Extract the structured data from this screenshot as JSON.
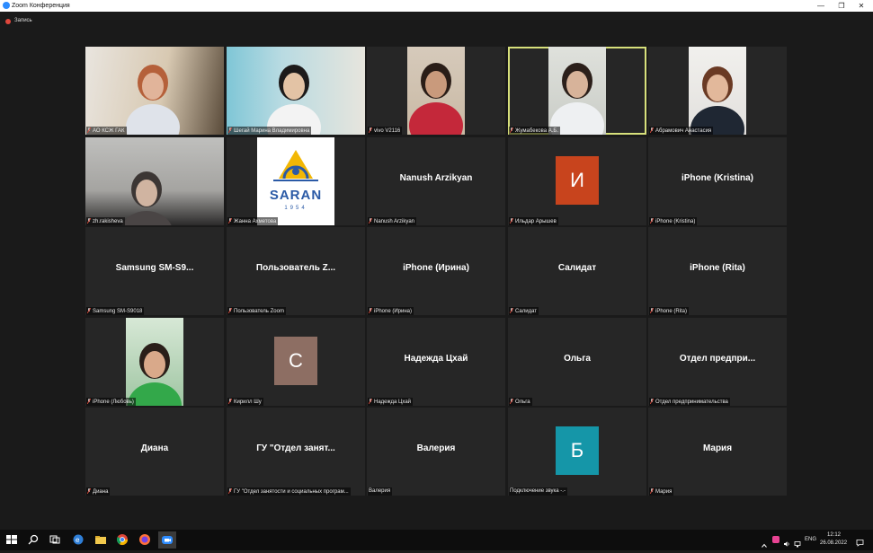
{
  "window": {
    "title": "Zoom Конференция"
  },
  "recording": {
    "label": "Запись"
  },
  "colors": {
    "active_speaker_border": "#d7e07b",
    "avatar_orange": "#c8441d",
    "avatar_brown": "#8d6e63",
    "avatar_teal": "#1596a8",
    "mute_icon": "#e04b3c"
  },
  "participants": [
    {
      "label": "АО КСЖ ГАК",
      "display": "",
      "type": "video"
    },
    {
      "label": "Шегай Марина Владимировна",
      "display": "",
      "type": "video"
    },
    {
      "label": "vivo V2116",
      "display": "",
      "type": "video"
    },
    {
      "label": "Жумабекова А.Б.",
      "display": "",
      "type": "video",
      "active": true
    },
    {
      "label": "Абрамович Анастасия",
      "display": "",
      "type": "video"
    },
    {
      "label": "zh.rakisheva",
      "display": "",
      "type": "video"
    },
    {
      "label": "Жанна Ахметова",
      "display": "",
      "type": "logo",
      "logo_text": "SARAN",
      "logo_year": "1954"
    },
    {
      "label": "Nanush Arzikyan",
      "display": "Nanush Arzikyan",
      "type": "name"
    },
    {
      "label": "Ильдар Арышев",
      "display": "",
      "type": "avatar",
      "initial": "И"
    },
    {
      "label": "iPhone (Kristina)",
      "display": "iPhone (Kristina)",
      "type": "name"
    },
    {
      "label": "Samsung SM-S9018",
      "display": "Samsung  SM-S9...",
      "type": "name"
    },
    {
      "label": "Пользователь Zoom",
      "display": "Пользователь  Z...",
      "type": "name"
    },
    {
      "label": "iPhone (Ирина)",
      "display": "iPhone (Ирина)",
      "type": "name"
    },
    {
      "label": "Салидат",
      "display": "Салидат",
      "type": "name"
    },
    {
      "label": "iPhone (Rita)",
      "display": "iPhone (Rita)",
      "type": "name"
    },
    {
      "label": "iPhone (Любовь)",
      "display": "",
      "type": "video"
    },
    {
      "label": "Кирилл Шу",
      "display": "",
      "type": "avatar",
      "initial": "С"
    },
    {
      "label": "Надежда Цхай",
      "display": "Надежда Цхай",
      "type": "name"
    },
    {
      "label": "Ольга",
      "display": "Ольга",
      "type": "name"
    },
    {
      "label": "Отдел предпринимательства",
      "display": "Отдел  предпри...",
      "type": "name"
    },
    {
      "label": "Диана",
      "display": "Диана",
      "type": "name"
    },
    {
      "label": "ГУ \"Отдел занятости и социальных програм...",
      "display": "ГУ  \"Отдел занят...",
      "type": "name"
    },
    {
      "label": "Валерия",
      "display": "Валерия",
      "type": "name",
      "muted": false
    },
    {
      "label": "Подключение звука -.-",
      "display": "",
      "type": "avatar",
      "initial": "Б",
      "muted": false
    },
    {
      "label": "Мария",
      "display": "Мария",
      "type": "name"
    }
  ],
  "taskbar": {
    "language": "ENG",
    "time": "12:12",
    "date": "26.08.2022",
    "icons": [
      "windows-start-icon",
      "search-icon",
      "task-view-icon",
      "edge-icon",
      "file-explorer-icon",
      "chrome-icon",
      "firefox-icon",
      "zoom-icon"
    ]
  }
}
